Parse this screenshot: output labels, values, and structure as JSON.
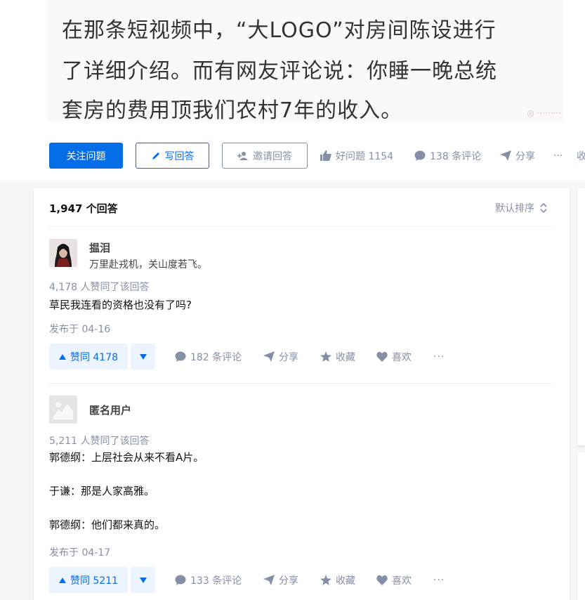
{
  "banner": {
    "lines": [
      "在那条短视频中，“大LOGO”对房间陈设进行",
      "了详细介绍。而有网友评论说：你睡一晚总统",
      "套房的费用顶我们农村7年的收入。"
    ]
  },
  "question_bar": {
    "follow_label": "关注问题",
    "write_label": "写回答",
    "invite_label": "邀请回答",
    "good_question_label": "好问题 1154",
    "comments_label": "138 条评论",
    "share_label": "分享",
    "more_label": "···",
    "cut_label": "收"
  },
  "list": {
    "count_label": "1,947 个回答",
    "sort_label": "默认排序"
  },
  "answers": [
    {
      "author": "揾泪",
      "bio": "万里赴戎机，关山度若飞。",
      "vote_meta": "4,178 人赞同了该回答",
      "paragraphs": [
        "草民我连看的资格也没有了吗?"
      ],
      "pubtime": "发布于 04-16",
      "upvote_label": "赞同 4178",
      "comments_label": "182 条评论",
      "share_label": "分享",
      "collect_label": "收藏",
      "like_label": "喜欢"
    },
    {
      "author": "匿名用户",
      "bio": "",
      "vote_meta": "5,211 人赞同了该回答",
      "paragraphs": [
        "郭德纲：上层社会从来不看A片。",
        "于谦：那是人家高雅。",
        "郭德纲：他们都来真的。"
      ],
      "pubtime": "发布于 04-17",
      "upvote_label": "赞同 5211",
      "comments_label": "133 条评论",
      "share_label": "分享",
      "collect_label": "收藏",
      "like_label": "喜欢"
    }
  ],
  "colors": {
    "accent": "#056de8",
    "muted": "#8590a6",
    "vote_bg": "#ebf4ff"
  }
}
